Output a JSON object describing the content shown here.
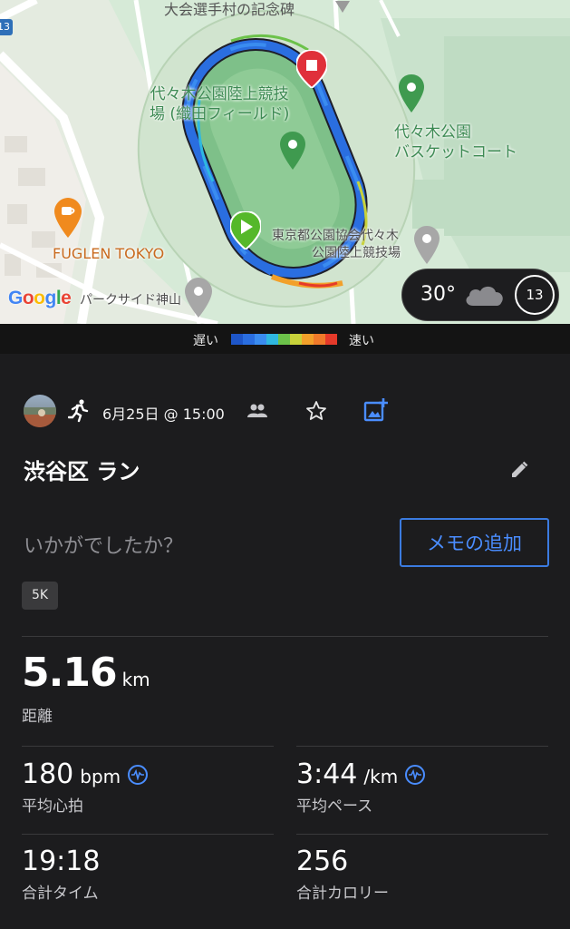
{
  "map": {
    "labels": {
      "top": "大会選手村の記念碑",
      "stadium_line1": "代々木公園陸上競技",
      "stadium_line2": "場 (織田フィールド)",
      "basket_line1": "代々木公園",
      "basket_line2": "バスケットコート",
      "assoc_line1": "東京都公園協会代々木",
      "assoc_line2": "公園陸上競技場",
      "cafe": "FUGLEN TOKYO",
      "parkside": "パークサイド神山",
      "route_number": "13"
    },
    "google_logo": {
      "g": "G",
      "o1": "o",
      "o2": "o",
      "g2": "g",
      "l": "l",
      "e": "e"
    },
    "weather": {
      "temperature": "30°",
      "badge": "13",
      "icon": "cloud-icon"
    }
  },
  "legend": {
    "slow": "遅い",
    "fast": "速い",
    "colors": [
      "#1e56c8",
      "#2a6ee0",
      "#3a8cf0",
      "#2fb8e0",
      "#6cc24a",
      "#c8d23a",
      "#f2a02a",
      "#f07a2a",
      "#e53a2a"
    ]
  },
  "activity": {
    "activity_type_icon": "runner-icon",
    "date": "6月25日 @ 15:00",
    "title": "渋谷区 ラン",
    "how_prompt": "いかがでしたか？",
    "memo_button": "メモの追加",
    "chip": "5K"
  },
  "stats": {
    "distance": {
      "value": "5.16",
      "unit": "km",
      "label": "距離"
    },
    "heart_rate": {
      "value": "180",
      "unit": "bpm",
      "label": "平均心拍"
    },
    "pace": {
      "value": "3:44",
      "unit": "/km",
      "label": "平均ペース"
    },
    "time": {
      "value": "19:18",
      "label": "合計タイム"
    },
    "calories": {
      "value": "256",
      "label": "合計カロリー"
    }
  },
  "colors": {
    "accent": "#4a8dff",
    "background": "#1c1c1e",
    "route_slow": "#1e56c8",
    "route_fast": "#e53a2a",
    "start_pin": "#55b82a",
    "end_pin": "#e0303a",
    "park_green": "#3d8a53"
  }
}
